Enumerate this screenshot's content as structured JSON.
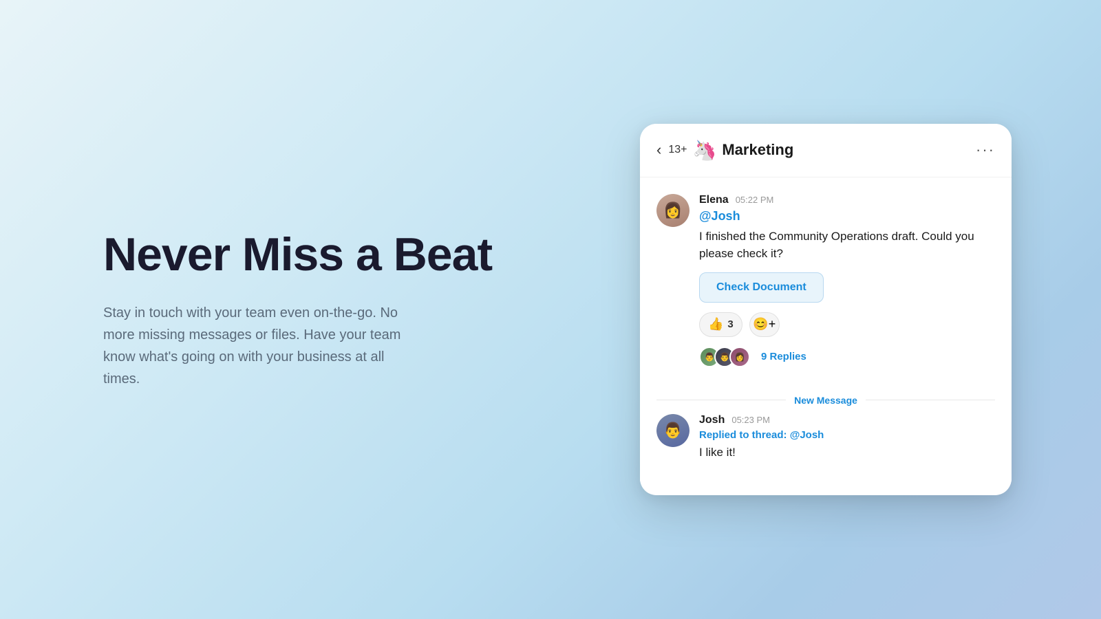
{
  "left": {
    "title": "Never Miss a Beat",
    "subtitle": "Stay in touch with your team even on-the-go. No more missing messages or files. Have your team know what's going on with your business at all times."
  },
  "chat": {
    "back_label": "‹",
    "member_count": "13+",
    "channel_emoji": "🦄",
    "channel_name": "Marketing",
    "more_label": "···",
    "messages": [
      {
        "sender": "Elena",
        "time": "05:22 PM",
        "mention": "@Josh",
        "text": "I finished the Community Operations draft. Could you please check it?",
        "doc_button": "Check Document",
        "reaction_emoji": "👍",
        "reaction_count": "3",
        "replies_count": "9 Replies"
      },
      {
        "sender": "Josh",
        "time": "05:23 PM",
        "replied_to_prefix": "Replied to thread:",
        "replied_to_mention": "@Josh",
        "text": "I like it!"
      }
    ],
    "new_message_label": "New Message"
  }
}
